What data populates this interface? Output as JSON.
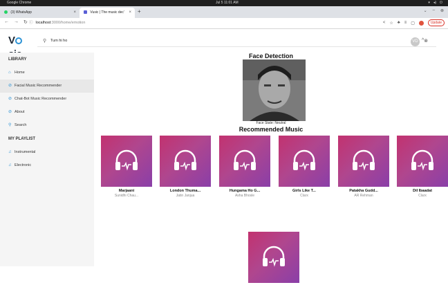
{
  "system_bar": {
    "app": "Google Chrome",
    "clock": "Jul 5  11:01 AM"
  },
  "browser": {
    "tabs": [
      {
        "label": "(3) WhatsApp",
        "color": "#25d366"
      },
      {
        "label": "Vusic | The music dec’",
        "color": "#5a5fd6"
      }
    ],
    "new_tab": "+",
    "url_host": "localhost",
    "url_path": ":3000/home/emotion",
    "update_label": "Update"
  },
  "app": {
    "logo_prefix": "V",
    "logo_suffix": "sic",
    "search_value": "Tum hi ho",
    "avatar_initials": "VD"
  },
  "sidebar": {
    "library_title": "LIBRARY",
    "library_items": [
      {
        "label": "Home",
        "icon": "home-icon"
      },
      {
        "label": "Facial Music Recommender",
        "icon": "check-circle-icon"
      },
      {
        "label": "Chat-Bot Music Recommender",
        "icon": "check-circle-icon"
      },
      {
        "label": "About",
        "icon": "check-circle-icon"
      },
      {
        "label": "Search",
        "icon": "search-icon"
      }
    ],
    "playlist_title": "MY PLAYLIST",
    "playlist_items": [
      {
        "label": "Instrumental",
        "icon": "music-note-icon"
      },
      {
        "label": "Electronic",
        "icon": "music-note-icon"
      }
    ]
  },
  "main": {
    "face_detection_title": "Face Detection",
    "face_state": "Face State: Neutral",
    "recommended_title": "Recommended Music",
    "songs": [
      {
        "title": "Marjaani",
        "artist": "Sunidhi Chau..."
      },
      {
        "title": "London Thuma...",
        "artist": "Jatin Janjua"
      },
      {
        "title": "Hungama Ho G...",
        "artist": "Asha Bhosle"
      },
      {
        "title": "Girls Like T...",
        "artist": "Clarx"
      },
      {
        "title": "Patakha Gudd...",
        "artist": "AR Rehman"
      },
      {
        "title": "Dil Ibaadat",
        "artist": "Clarx"
      },
      {
        "title": "",
        "artist": ""
      }
    ]
  },
  "colors": {
    "accent": "#2c93d6",
    "cover_start": "#c2326f",
    "cover_end": "#8a3fa8"
  }
}
